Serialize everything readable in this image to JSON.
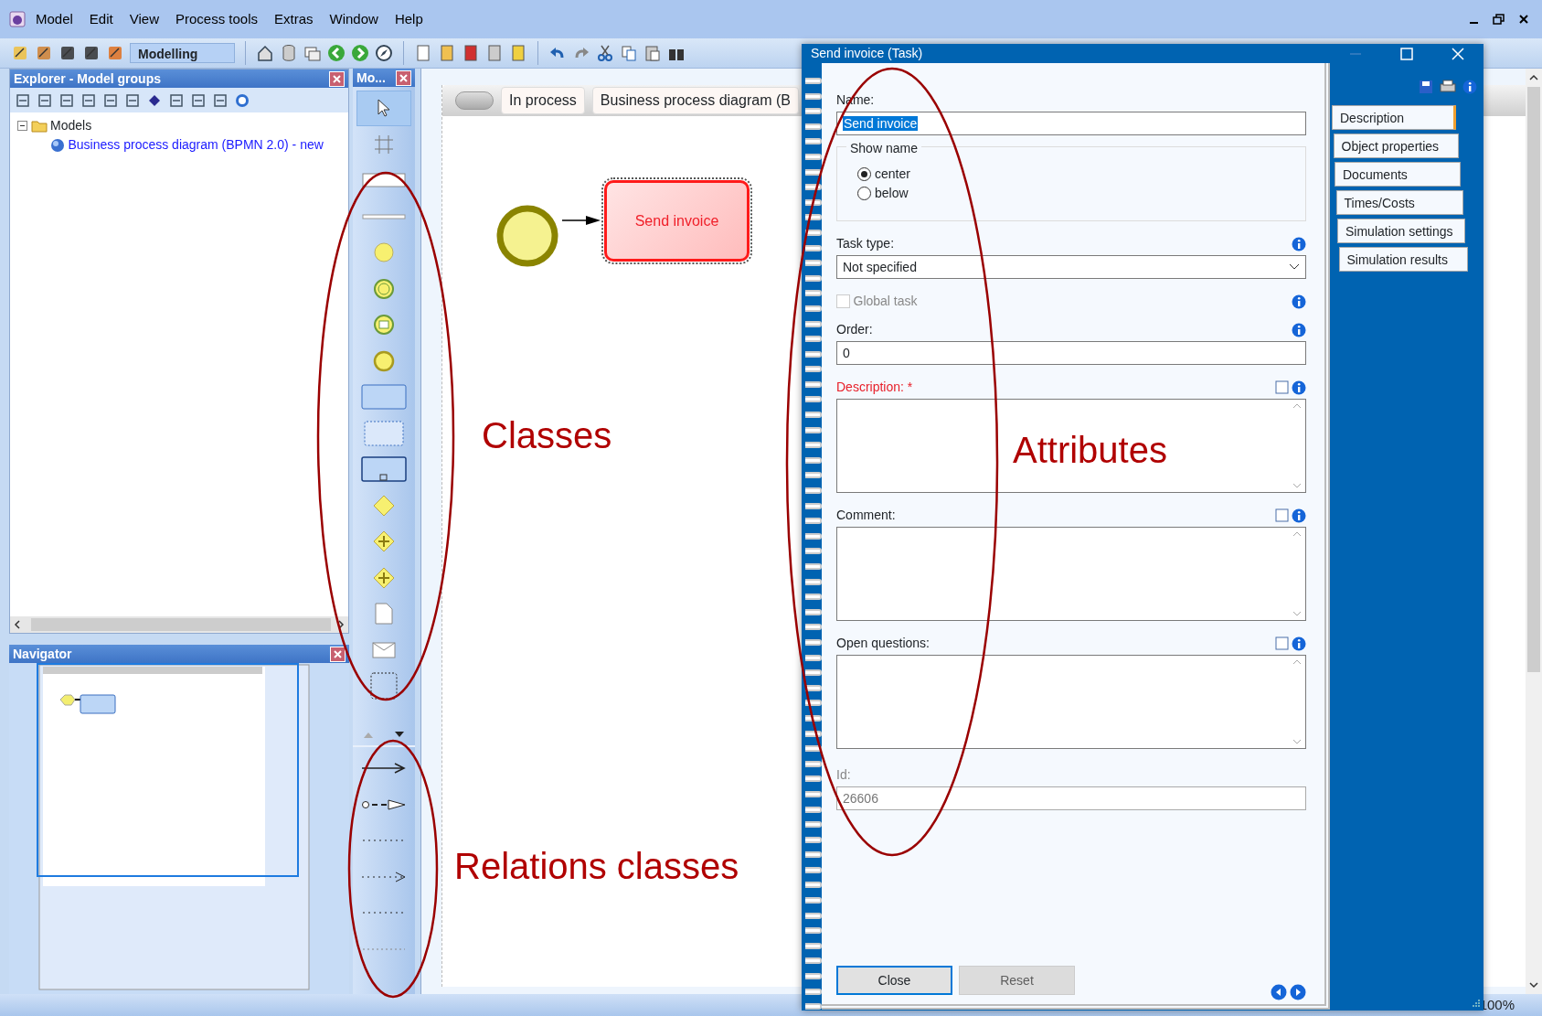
{
  "menu": [
    {
      "label": "Model"
    },
    {
      "label": "Edit"
    },
    {
      "label": "View"
    },
    {
      "label": "Process tools"
    },
    {
      "label": "Extras"
    },
    {
      "label": "Window"
    },
    {
      "label": "Help"
    }
  ],
  "mode_field": "Modelling",
  "explorer": {
    "title": "Explorer - Model groups",
    "tree": [
      {
        "label": "Models",
        "expanded": true,
        "children": [
          {
            "label": "Business process diagram (BPMN 2.0) - new"
          }
        ]
      }
    ]
  },
  "navigator": {
    "title": "Navigator"
  },
  "palette": {
    "title": "Mo...",
    "tools": [
      {
        "kind": "pointer",
        "selected": true
      },
      {
        "kind": "grid",
        "selected": false
      },
      {
        "kind": "pool",
        "selected": false
      },
      {
        "kind": "lane",
        "selected": false
      },
      {
        "kind": "start",
        "selected": false
      },
      {
        "kind": "timer",
        "selected": false
      },
      {
        "kind": "message-event",
        "selected": false
      },
      {
        "kind": "end",
        "selected": false
      },
      {
        "kind": "task",
        "selected": false
      },
      {
        "kind": "subprocess",
        "selected": false
      },
      {
        "kind": "collapsed",
        "selected": false
      },
      {
        "kind": "gateway",
        "selected": false
      },
      {
        "kind": "plus-gateway",
        "selected": false
      },
      {
        "kind": "plus-gateway",
        "selected": false
      },
      {
        "kind": "document",
        "selected": false
      },
      {
        "kind": "envelope",
        "selected": false
      },
      {
        "kind": "group",
        "selected": false
      }
    ],
    "relations": [
      {
        "kind": "sequence",
        "selected": false
      },
      {
        "kind": "message-flow",
        "selected": false
      },
      {
        "kind": "dotted",
        "selected": false
      },
      {
        "kind": "dotted-arrow",
        "selected": false
      },
      {
        "kind": "dotted",
        "selected": false
      },
      {
        "kind": "faint-dotted",
        "selected": false
      }
    ]
  },
  "canvas": {
    "header_tabs": [
      "In process",
      "Business process diagram (B"
    ],
    "task": {
      "label": "Send invoice",
      "selected": true
    }
  },
  "dialog": {
    "title": "Send invoice (Task)",
    "name_label": "Name:",
    "name_value": "Send invoice",
    "show_name_legend": "Show name",
    "radios": [
      {
        "label": "center",
        "selected": true
      },
      {
        "label": "below",
        "selected": false
      }
    ],
    "task_type_label": "Task type:",
    "task_type_value": "Not specified",
    "global_task": {
      "label": "Global task",
      "checked": false,
      "disabled": true
    },
    "order_label": "Order:",
    "order_value": "0",
    "text_areas": [
      {
        "label": "Description: *",
        "required": true
      },
      {
        "label": "Comment:",
        "required": false
      },
      {
        "label": "Open questions:",
        "required": false
      }
    ],
    "id_label": "Id:",
    "id_value": "26606",
    "tabs": [
      {
        "label": "Description",
        "selected": true
      },
      {
        "label": "Object properties",
        "selected": false
      },
      {
        "label": "Documents",
        "selected": false
      },
      {
        "label": "Times/Costs",
        "selected": false
      },
      {
        "label": "Simulation settings",
        "selected": false
      },
      {
        "label": "Simulation results",
        "selected": false
      }
    ],
    "buttons": [
      {
        "label": "Close",
        "disabled": false
      },
      {
        "label": "Reset",
        "disabled": true
      }
    ]
  },
  "annotations": [
    {
      "text": "Classes"
    },
    {
      "text": "Attributes"
    },
    {
      "text": "Relations classes"
    }
  ],
  "status_bar": {
    "zoom": "100%"
  }
}
